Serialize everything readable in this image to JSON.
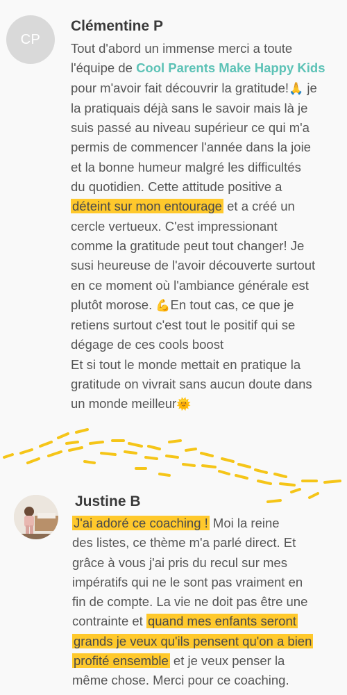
{
  "theme": {
    "highlight": "#ffc92c",
    "brand": "#5cc2b6",
    "text": "#555555",
    "flourish": "#f5c518"
  },
  "reviews": [
    {
      "avatar_initials": "CP",
      "author": "Clémentine P",
      "lines": {
        "l1": "Tout d'abord un immense merci a toute",
        "l2_pre": "l'équipe de ",
        "l2_brand": "Cool Parents Make Happy Kids",
        "l3_pre": "pour m'avoir fait découvrir la gratitude!",
        "l3_emoji": "🙏",
        "l3_post": " je",
        "l4": "la pratiquais déjà sans le savoir mais là je",
        "l5": "suis passé au niveau supérieur ce qui m'a",
        "l6": "permis de commencer l'année dans la joie",
        "l7": "et la bonne humeur malgré les difficultés",
        "l8": "du quotidien. Cette attitude positive a",
        "l9_hl": "déteint sur mon entourage",
        "l9_post": " et a créé un",
        "l10": "cercle vertueux. C'est impressionant",
        "l11": "comme la gratitude peut tout changer! Je",
        "l12": "susi heureuse de l'avoir découverte surtout",
        "l13": "en ce moment où l'ambiance générale est",
        "l14_pre": "plutôt morose. ",
        "l14_emoji": "💪",
        "l14_post": "En tout cas, ce que je",
        "l15": "retiens surtout c'est tout le positif qui se",
        "l16": "dégage de ces cools boost",
        "l17": "Et si tout le monde mettait en pratique la",
        "l18": "gratitude on vivrait sans aucun doute dans",
        "l19_pre": "un monde meilleur",
        "l19_emoji": "🌞"
      }
    },
    {
      "author": "Justine B",
      "avatar_icon": "profile-photo",
      "lines": {
        "l1_hl": "J'ai adoré ce coaching !",
        "l1_post": " Moi la reine",
        "l2": "des listes, ce thème m'a parlé direct. Et",
        "l3": "grâce à vous j'ai pris du recul sur mes",
        "l4": "impératifs qui ne le sont pas vraiment en",
        "l5": "fin de compte. La vie ne doit pas être une",
        "l6_pre": "contrainte et ",
        "l6_hl": "quand mes enfants seront",
        "l7_hl": "grands je veux qu'ils pensent qu'on a bien",
        "l8_hl": "profité ensemble",
        "l8_post": " et je veux penser la",
        "l9": "même chose. Merci pour ce coaching."
      }
    }
  ]
}
